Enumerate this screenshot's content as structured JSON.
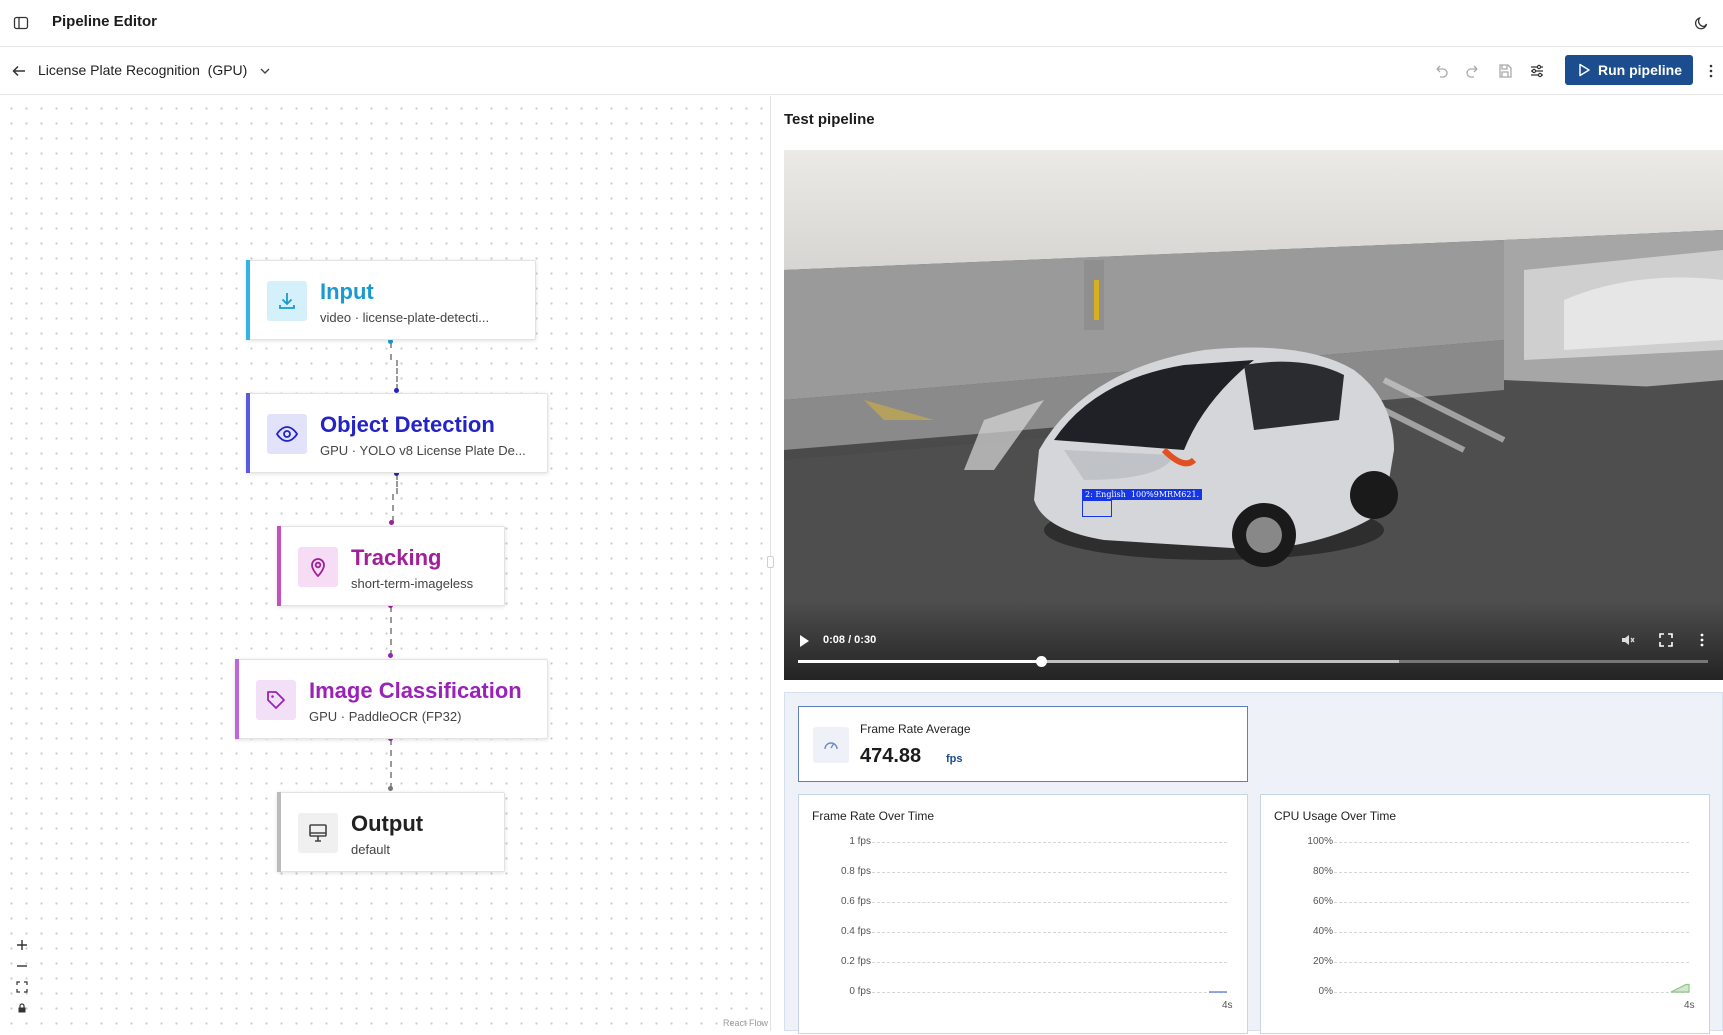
{
  "app": {
    "title": "Pipeline Editor"
  },
  "toolbar": {
    "pipeline_name": "License Plate Recognition  (GPU)",
    "run_label": "Run pipeline"
  },
  "nodes": [
    {
      "title": "Input",
      "subtitle": "video · license-plate-detecti...",
      "color": "#1a9ad0",
      "icon": "download-icon"
    },
    {
      "title": "Object Detection",
      "subtitle": "GPU · YOLO v8 License Plate De...",
      "color": "#2323c8",
      "icon": "eye-icon"
    },
    {
      "title": "Tracking",
      "subtitle": "short-term-imageless",
      "color": "#a0209a",
      "icon": "map-pin-icon"
    },
    {
      "title": "Image Classification",
      "subtitle": "GPU · PaddleOCR (FP32)",
      "color": "#9b22b8",
      "icon": "tag-icon"
    },
    {
      "title": "Output",
      "subtitle": "default",
      "color": "#222222",
      "icon": "monitor-icon"
    }
  ],
  "canvas": {
    "attribution": "React Flow"
  },
  "test_panel": {
    "title": "Test pipeline",
    "video": {
      "time": "0:08 / 0:30",
      "progress": 0.267,
      "buffered": 0.66,
      "detection_label": "2: English  100%9MRM621."
    }
  },
  "stats": {
    "frame_rate_avg": {
      "label": "Frame Rate Average",
      "value": "474.88",
      "unit": "fps"
    },
    "frame_rate_chart": {
      "title": "Frame Rate Over Time",
      "yticks": [
        "1 fps",
        "0.8 fps",
        "0.6 fps",
        "0.4 fps",
        "0.2 fps",
        "0 fps"
      ],
      "xtick": "4s"
    },
    "cpu_chart": {
      "title": "CPU Usage Over Time",
      "yticks": [
        "100%",
        "80%",
        "60%",
        "40%",
        "20%",
        "0%"
      ],
      "xtick": "4s"
    }
  },
  "chart_data": [
    {
      "type": "line",
      "title": "Frame Rate Over Time",
      "ylim": [
        0,
        1
      ],
      "x": [
        "4s"
      ],
      "series": [
        {
          "values": [
            0
          ]
        }
      ]
    },
    {
      "type": "area",
      "title": "CPU Usage Over Time",
      "ylim": [
        0,
        100
      ],
      "x": [
        "4s"
      ],
      "series": [
        {
          "values": [
            5
          ]
        }
      ]
    }
  ]
}
